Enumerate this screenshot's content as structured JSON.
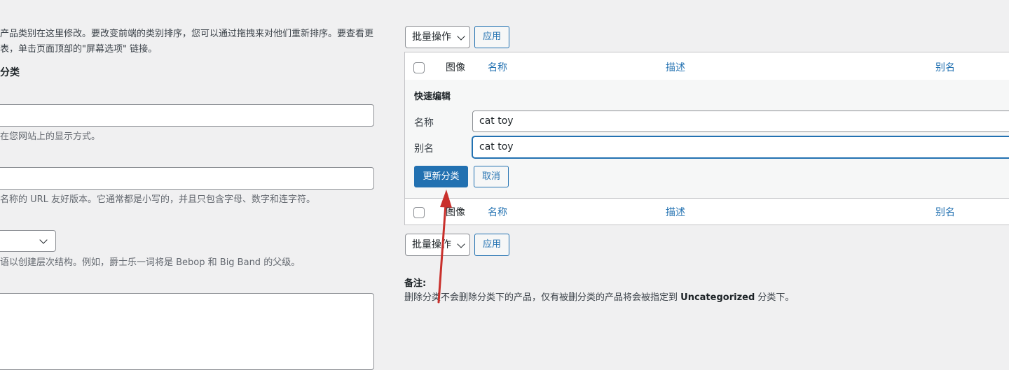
{
  "left_panel": {
    "intro_line1": "产品类别在这里修改。要改变前端的类别排序，您可以通过拖拽来对他们重新排序。要查看更",
    "intro_line2": "表，单击页面顶部的\"屏幕选项\" 链接。",
    "section_heading": "分类",
    "name_help": "在您网站上的显示方式。",
    "slug_help": "名称的 URL 友好版本。它通常都是小写的，并且只包含字母、数字和连字符。",
    "parent_help": "语以创建层次结构。例如，爵士乐一词将是 Bebop 和 Big Band 的父级。"
  },
  "bulk_actions": {
    "select_label": "批量操作",
    "apply_label": "应用"
  },
  "table": {
    "columns": {
      "image": "图像",
      "name": "名称",
      "description": "描述",
      "slug": "别名"
    }
  },
  "quick_edit": {
    "title": "快速编辑",
    "name_label": "名称",
    "name_value": "cat toy",
    "slug_label": "别名",
    "slug_value": "cat toy",
    "update_label": "更新分类",
    "cancel_label": "取消"
  },
  "note": {
    "title": "备注:",
    "text_before": "删除分类不会删除分类下的产品，仅有被删分类的产品将会被指定到 ",
    "text_bold": "Uncategorized",
    "text_after": " 分类下。"
  },
  "annotation": {
    "arrow_color": "#c9302c"
  }
}
